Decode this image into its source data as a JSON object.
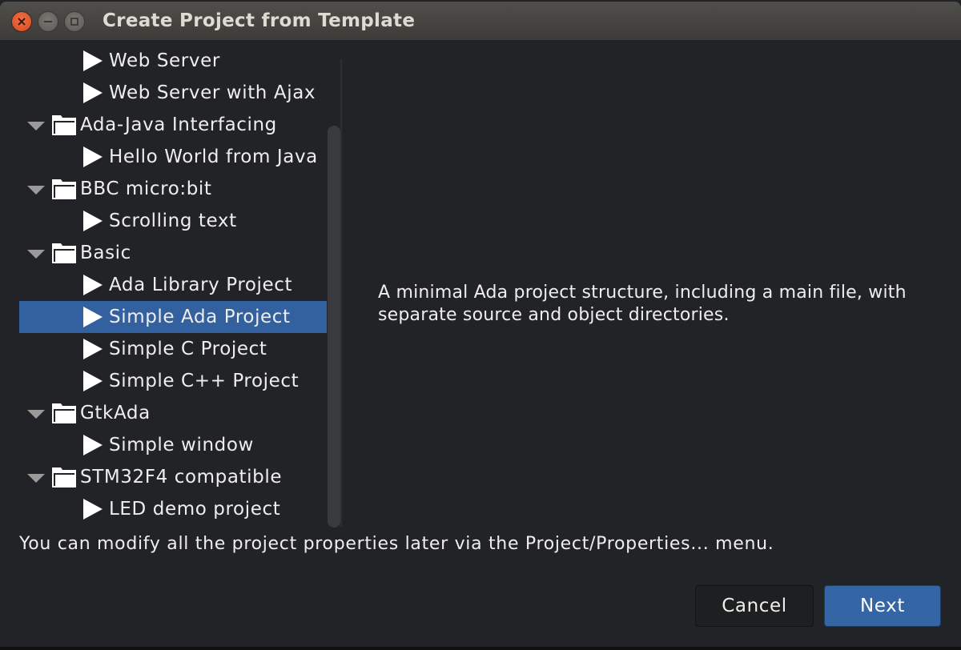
{
  "window": {
    "title": "Create Project from Template",
    "controls": [
      "close",
      "minimize",
      "maximize"
    ]
  },
  "tree": {
    "rows": [
      {
        "type": "leaf",
        "label": "Web Server",
        "selected": false
      },
      {
        "type": "leaf",
        "label": "Web Server with Ajax",
        "selected": false
      },
      {
        "type": "category",
        "label": "Ada-Java Interfacing",
        "expanded": true
      },
      {
        "type": "leaf",
        "label": "Hello World from Java",
        "selected": false
      },
      {
        "type": "category",
        "label": "BBC micro:bit",
        "expanded": true
      },
      {
        "type": "leaf",
        "label": "Scrolling text",
        "selected": false
      },
      {
        "type": "category",
        "label": "Basic",
        "expanded": true
      },
      {
        "type": "leaf",
        "label": "Ada Library Project",
        "selected": false
      },
      {
        "type": "leaf",
        "label": "Simple Ada Project",
        "selected": true
      },
      {
        "type": "leaf",
        "label": "Simple C Project",
        "selected": false
      },
      {
        "type": "leaf",
        "label": "Simple C++ Project",
        "selected": false
      },
      {
        "type": "category",
        "label": "GtkAda",
        "expanded": true
      },
      {
        "type": "leaf",
        "label": "Simple window",
        "selected": false
      },
      {
        "type": "category",
        "label": "STM32F4 compatible",
        "expanded": true
      },
      {
        "type": "leaf",
        "label": "LED demo project",
        "selected": false
      }
    ]
  },
  "description": "A minimal Ada project structure, including a main file, with separate source and object directories.",
  "hint": "You can modify all the project properties later via the Project/Properties... menu.",
  "buttons": {
    "cancel": "Cancel",
    "next": "Next"
  },
  "colors": {
    "selection": "#33609e",
    "primary_button": "#3465a4",
    "close_button": "#e95420"
  }
}
